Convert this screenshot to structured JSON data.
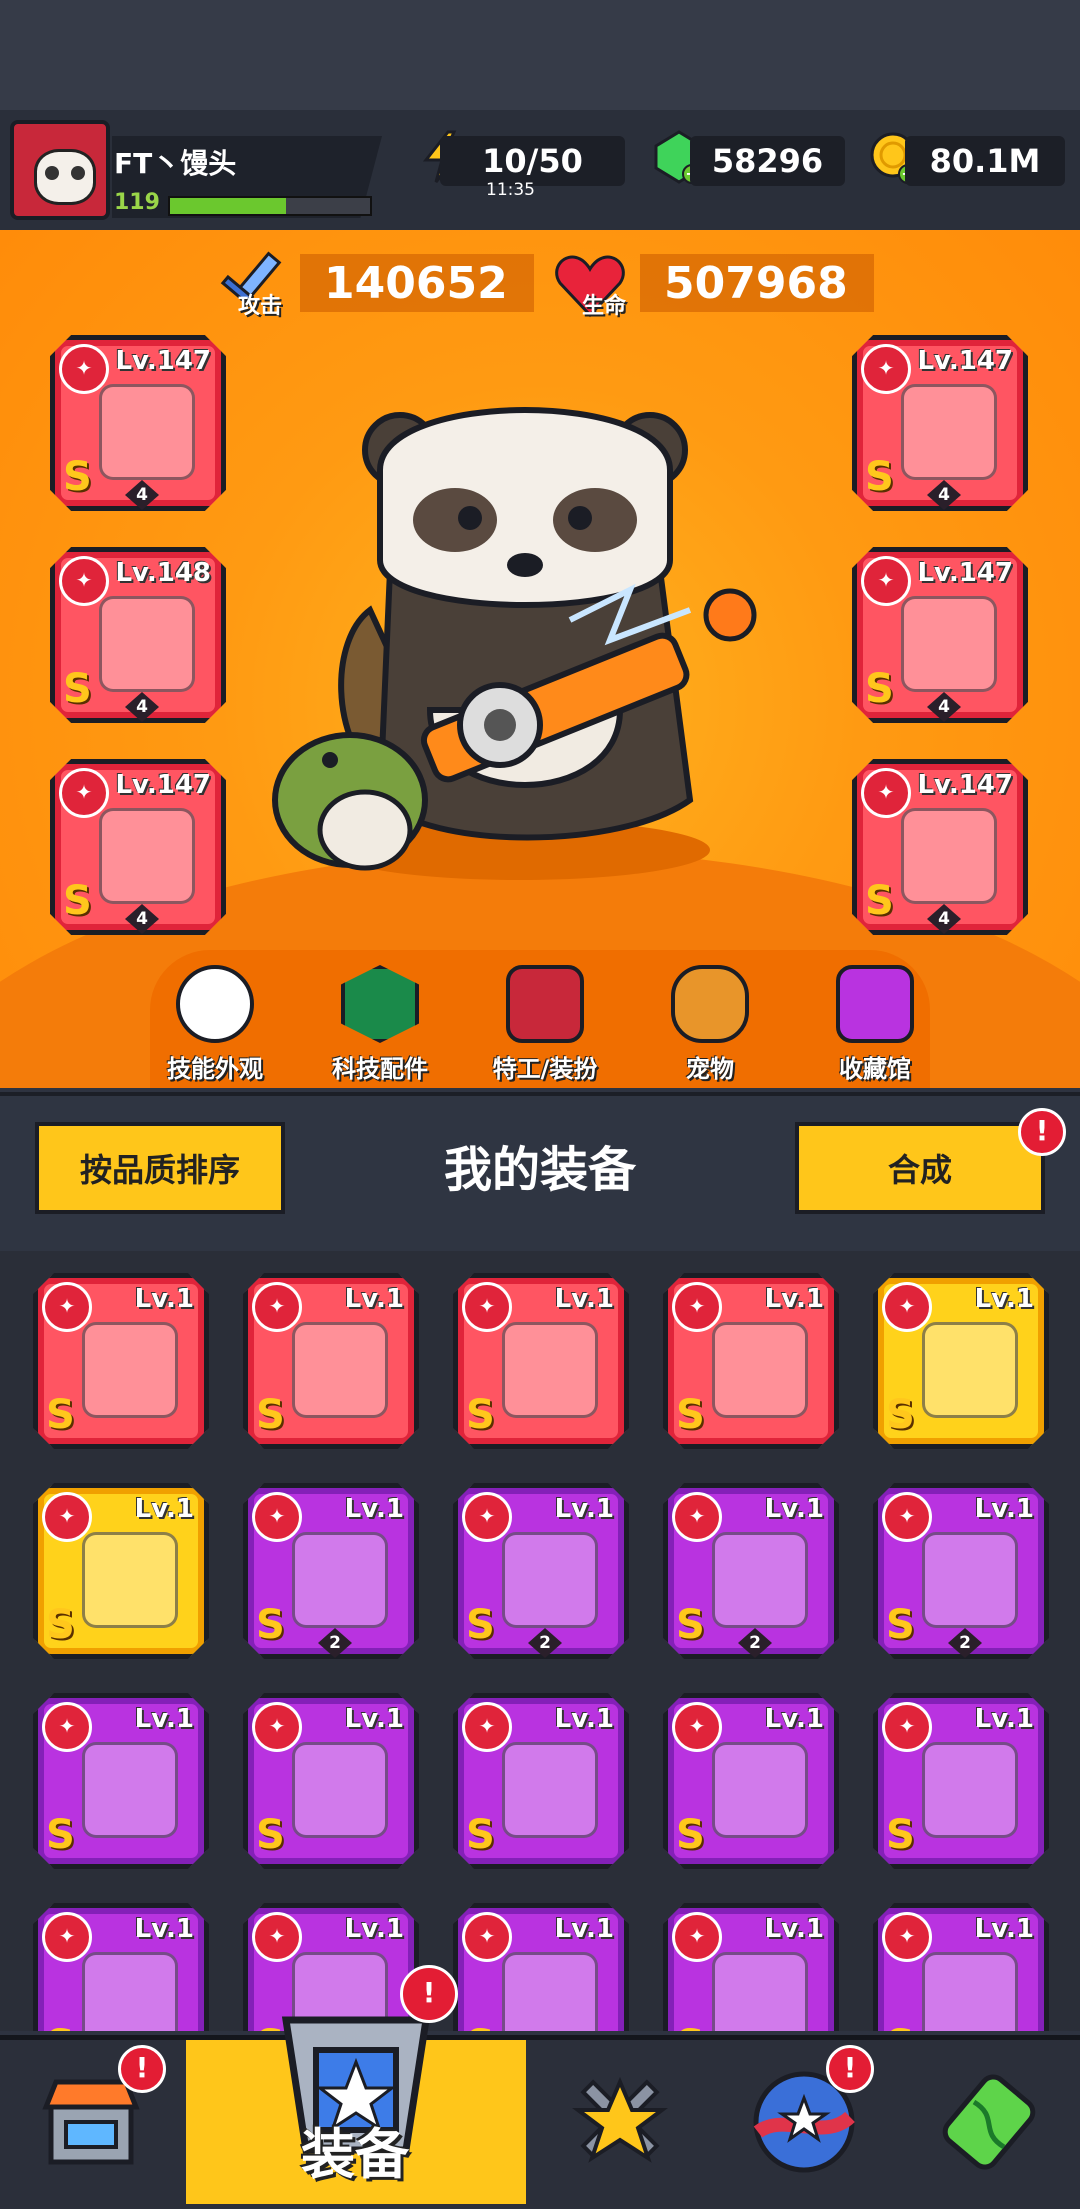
{
  "player": {
    "name": "FT丶馒头",
    "level": "119",
    "xp_fraction": 0.58
  },
  "resources": {
    "energy": "10/50",
    "energy_timer": "11:35",
    "gems": "58296",
    "coins": "80.1M"
  },
  "stats": {
    "attack_label": "攻击",
    "attack": "140652",
    "hp_label": "生命",
    "hp": "507968"
  },
  "equipped": {
    "left": [
      {
        "level": "Lv.147",
        "grade": "S",
        "stars": "4",
        "icon": "scope-gun-icon"
      },
      {
        "level": "Lv.148",
        "grade": "S",
        "stars": "4",
        "icon": "star-necklace-icon"
      },
      {
        "level": "Lv.147",
        "grade": "S",
        "stars": "4",
        "icon": "gauntlet-icon"
      }
    ],
    "right": [
      {
        "level": "Lv.147",
        "grade": "S",
        "stars": "4",
        "icon": "armor-icon"
      },
      {
        "level": "Lv.147",
        "grade": "S",
        "stars": "4",
        "icon": "belt-icon"
      },
      {
        "level": "Lv.147",
        "grade": "S",
        "stars": "4",
        "icon": "boot-icon"
      }
    ]
  },
  "shortcut_tabs": [
    "技能外观",
    "科技配件",
    "特工/装扮",
    "宠物",
    "收藏馆"
  ],
  "inventory": {
    "sort_button": "按品质排序",
    "title": "我的装备",
    "merge_button": "合成",
    "merge_badge": "!",
    "items": [
      {
        "level": "Lv.1",
        "grade": "S",
        "rarity": "red",
        "icon": "feather-icon",
        "stars": ""
      },
      {
        "level": "Lv.1",
        "grade": "S",
        "rarity": "red",
        "icon": "belt-icon",
        "stars": ""
      },
      {
        "level": "Lv.1",
        "grade": "S",
        "rarity": "red",
        "icon": "kunai-icon",
        "stars": ""
      },
      {
        "level": "Lv.1",
        "grade": "S",
        "rarity": "red",
        "icon": "boot-icon",
        "stars": ""
      },
      {
        "level": "Lv.1",
        "grade": "S",
        "rarity": "gold",
        "icon": "water-gun-icon",
        "stars": ""
      },
      {
        "level": "Lv.1",
        "grade": "S",
        "rarity": "gold",
        "icon": "water-gun-icon",
        "stars": ""
      },
      {
        "level": "Lv.1",
        "grade": "S",
        "rarity": "purple",
        "icon": "gauntlet-icon",
        "stars": "2"
      },
      {
        "level": "Lv.1",
        "grade": "S",
        "rarity": "purple",
        "icon": "gauntlet-icon",
        "stars": "2"
      },
      {
        "level": "Lv.1",
        "grade": "S",
        "rarity": "purple",
        "icon": "gauntlet-icon",
        "stars": "2"
      },
      {
        "level": "Lv.1",
        "grade": "S",
        "rarity": "purple",
        "icon": "gauntlet-icon",
        "stars": "2"
      },
      {
        "level": "Lv.1",
        "grade": "S",
        "rarity": "purple",
        "icon": "water-gun-icon",
        "stars": ""
      },
      {
        "level": "Lv.1",
        "grade": "S",
        "rarity": "purple",
        "icon": "water-gun-icon",
        "stars": ""
      },
      {
        "level": "Lv.1",
        "grade": "S",
        "rarity": "purple",
        "icon": "water-gun-icon",
        "stars": ""
      },
      {
        "level": "Lv.1",
        "grade": "S",
        "rarity": "purple",
        "icon": "dark-armor-icon",
        "stars": ""
      },
      {
        "level": "Lv.1",
        "grade": "S",
        "rarity": "purple",
        "icon": "dark-armor-icon",
        "stars": ""
      },
      {
        "level": "Lv.1",
        "grade": "S",
        "rarity": "purple",
        "icon": "dark-armor-icon",
        "stars": ""
      },
      {
        "level": "Lv.1",
        "grade": "S",
        "rarity": "purple",
        "icon": "dark-armor-icon",
        "stars": ""
      },
      {
        "level": "Lv.1",
        "grade": "S",
        "rarity": "purple",
        "icon": "silver-armor-icon",
        "stars": ""
      },
      {
        "level": "Lv.1",
        "grade": "S",
        "rarity": "purple",
        "icon": "silver-armor-icon",
        "stars": ""
      },
      {
        "level": "Lv.1",
        "grade": "S",
        "rarity": "purple",
        "icon": "chain-necklace-icon",
        "stars": ""
      }
    ]
  },
  "bottom_nav": {
    "active_label": "装备",
    "badge": "!"
  },
  "colors": {
    "accent": "#ffc61a",
    "red_rarity": "#ff5562",
    "gold_rarity": "#ffd21b",
    "purple_rarity": "#b933e0"
  }
}
